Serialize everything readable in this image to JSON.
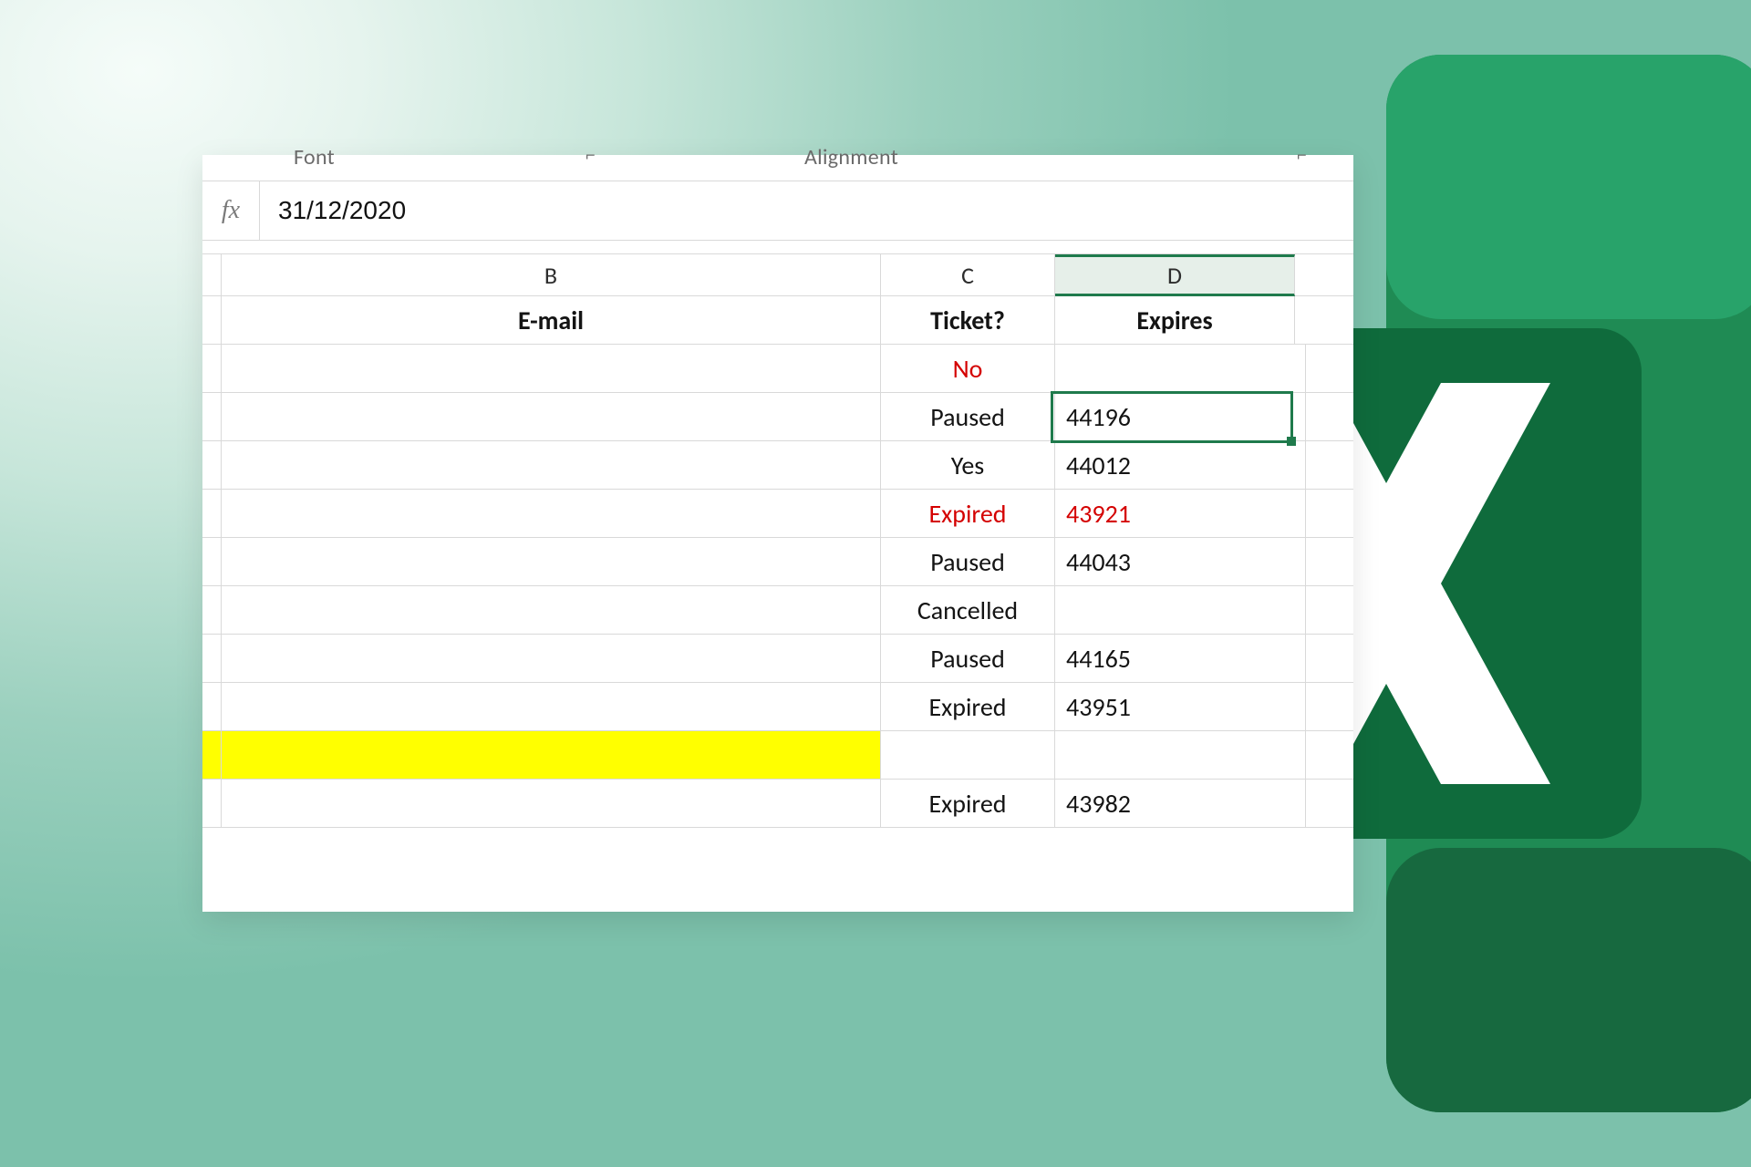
{
  "ribbon": {
    "group_font": "Font",
    "group_align": "Alignment"
  },
  "formula_bar": {
    "fx_label": "fx",
    "value": "31/12/2020"
  },
  "columns": {
    "B": "B",
    "C": "C",
    "D": "D"
  },
  "headers": {
    "email": "E-mail",
    "ticket": "Ticket?",
    "expires": "Expires"
  },
  "rows": [
    {
      "ticket": "No",
      "ticket_red": true,
      "expires": ""
    },
    {
      "ticket": "Paused",
      "ticket_red": false,
      "expires": "44196",
      "active": true
    },
    {
      "ticket": "Yes",
      "ticket_red": false,
      "expires": "44012"
    },
    {
      "ticket": "Expired",
      "ticket_red": true,
      "expires": "43921",
      "expires_red": true
    },
    {
      "ticket": "Paused",
      "ticket_red": false,
      "expires": "44043"
    },
    {
      "ticket": "Cancelled",
      "ticket_red": false,
      "expires": ""
    },
    {
      "ticket": "Paused",
      "ticket_red": false,
      "expires": "44165"
    },
    {
      "ticket": "Expired",
      "ticket_red": false,
      "expires": "43951"
    },
    {
      "ticket": "",
      "ticket_red": false,
      "expires": "",
      "highlight": true
    },
    {
      "ticket": "Expired",
      "ticket_red": false,
      "expires": "43982"
    }
  ],
  "chart_data": {
    "type": "table",
    "columns": [
      "E-mail",
      "Ticket?",
      "Expires"
    ],
    "rows": [
      [
        "",
        "No",
        ""
      ],
      [
        "",
        "Paused",
        "44196"
      ],
      [
        "",
        "Yes",
        "44012"
      ],
      [
        "",
        "Expired",
        "43921"
      ],
      [
        "",
        "Paused",
        "44043"
      ],
      [
        "",
        "Cancelled",
        ""
      ],
      [
        "",
        "Paused",
        "44165"
      ],
      [
        "",
        "Expired",
        "43951"
      ],
      [
        "",
        "",
        ""
      ],
      [
        "",
        "Expired",
        "43982"
      ]
    ],
    "notes": "Active cell D3 shows serial 44196; formula bar displays 31/12/2020"
  }
}
